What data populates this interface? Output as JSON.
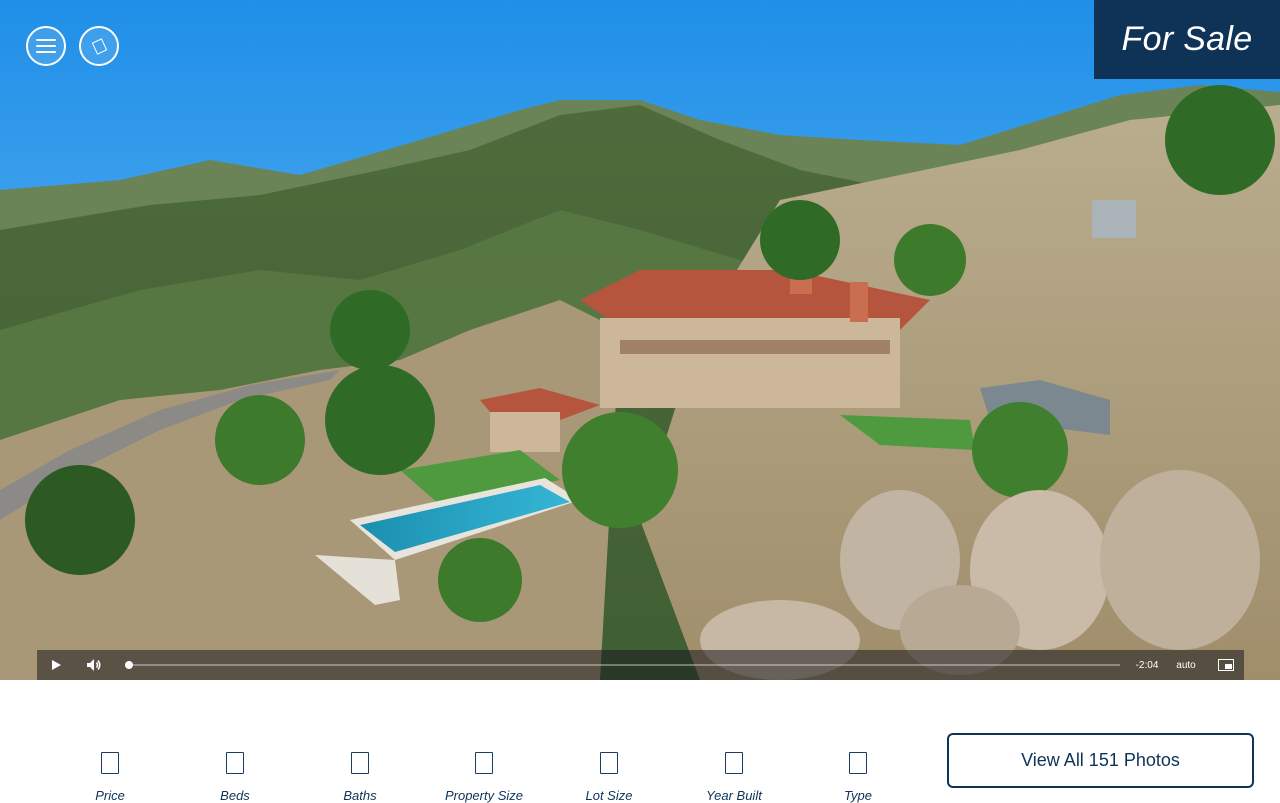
{
  "header": {
    "menu_icon": "hamburger-menu-icon",
    "share_icon": "share-icon",
    "badge_label": "For Sale"
  },
  "video_player": {
    "progress_fraction": 0.0,
    "time_remaining": "-2:04",
    "quality": "auto",
    "icons": [
      "play-icon",
      "volume-icon",
      "picture-in-picture-icon"
    ]
  },
  "stats": [
    {
      "label": "Price",
      "icon": "price-icon"
    },
    {
      "label": "Beds",
      "icon": "bed-icon"
    },
    {
      "label": "Baths",
      "icon": "bath-icon"
    },
    {
      "label": "Property Size",
      "icon": "property-size-icon"
    },
    {
      "label": "Lot Size",
      "icon": "lot-size-icon"
    },
    {
      "label": "Year Built",
      "icon": "calendar-icon"
    },
    {
      "label": "Type",
      "icon": "home-type-icon"
    }
  ],
  "photos_button": {
    "label": "View All 151 Photos"
  },
  "colors": {
    "brand_navy": "#0f3357",
    "sky_blue": "#2c9ef0",
    "button_border": "#0f3357"
  }
}
